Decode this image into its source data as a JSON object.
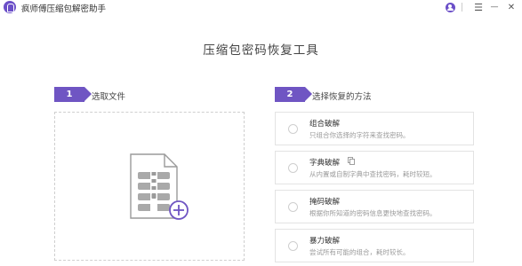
{
  "window": {
    "title": "疯师傅压缩包解密助手",
    "controls": {
      "user": "user-icon",
      "menu": "☰",
      "minimize": "—",
      "close": "✕"
    }
  },
  "page": {
    "title": "压缩包密码恢复工具"
  },
  "steps": [
    {
      "number": "1",
      "label": "选取文件"
    },
    {
      "number": "2",
      "label": "选择恢复的方法"
    }
  ],
  "drop_zone": {
    "icon": "zip-file-add-icon"
  },
  "methods": [
    {
      "title": "组合破解",
      "desc": "只组合你选择的字符来查找密码。"
    },
    {
      "title": "字典破解",
      "desc": "从内置或自制字典中查找密码，耗时较短。",
      "icon": "copy-icon"
    },
    {
      "title": "掩码破解",
      "desc": "根据你所知道的密码信息更快地查找密码。"
    },
    {
      "title": "暴力破解",
      "desc": "尝试所有可能的组合，耗时较长。"
    }
  ],
  "colors": {
    "accent": "#6f55c3",
    "logo": "#6b4fc8",
    "border": "#e3e3e3"
  }
}
